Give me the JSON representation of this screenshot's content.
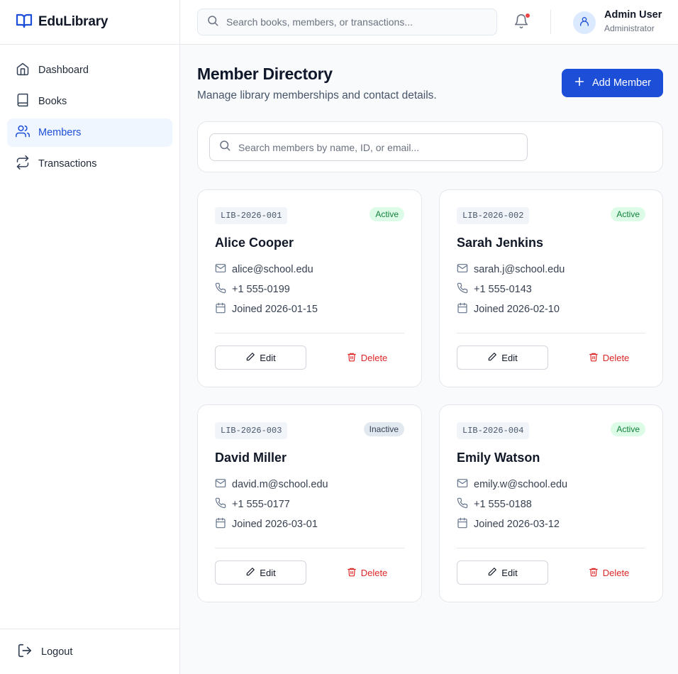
{
  "app": {
    "name": "EduLibrary"
  },
  "sidebar": {
    "items": [
      {
        "label": "Dashboard",
        "icon": "home-icon"
      },
      {
        "label": "Books",
        "icon": "book-icon"
      },
      {
        "label": "Members",
        "icon": "users-icon",
        "active": true
      },
      {
        "label": "Transactions",
        "icon": "arrows-icon"
      }
    ],
    "logout_label": "Logout"
  },
  "header": {
    "search_placeholder": "Search books, members, or transactions...",
    "user_name": "Admin User",
    "user_role": "Administrator",
    "notification_dot": true
  },
  "main": {
    "title": "Member Directory",
    "subtitle": "Manage library memberships and contact details.",
    "add_button_label": "Add Member",
    "member_search_placeholder": "Search members by name, ID, or email..."
  },
  "members": [
    {
      "id": "LIB-2026-001",
      "status": "Active",
      "name": "Alice Cooper",
      "email": "alice@school.edu",
      "phone": "+1 555-0199",
      "joined": "Joined 2026-01-15"
    },
    {
      "id": "LIB-2026-002",
      "status": "Active",
      "name": "Sarah Jenkins",
      "email": "sarah.j@school.edu",
      "phone": "+1 555-0143",
      "joined": "Joined 2026-02-10"
    },
    {
      "id": "LIB-2026-003",
      "status": "Inactive",
      "name": "David Miller",
      "email": "david.m@school.edu",
      "phone": "+1 555-0177",
      "joined": "Joined 2026-03-01"
    },
    {
      "id": "LIB-2026-004",
      "status": "Active",
      "name": "Emily Watson",
      "email": "emily.w@school.edu",
      "phone": "+1 555-0188",
      "joined": "Joined 2026-03-12"
    }
  ],
  "card_actions": {
    "edit_label": "Edit",
    "delete_label": "Delete"
  },
  "colors": {
    "accent": "#1d4ed8",
    "active_badge_bg": "#dcfce7",
    "active_badge_text": "#15803d",
    "inactive_badge_bg": "#e2e8f0",
    "delete": "#dc2626",
    "notification": "#ef4444"
  }
}
